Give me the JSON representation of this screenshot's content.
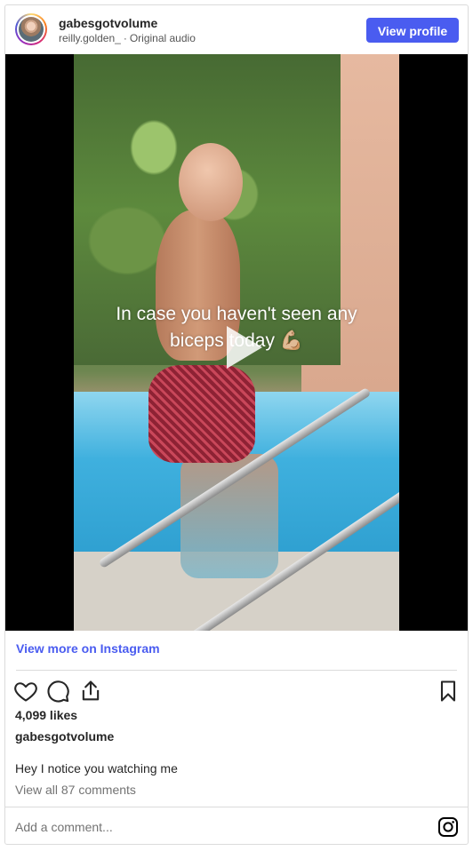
{
  "header": {
    "username": "gabesgotvolume",
    "audio_owner": "reilly.golden_",
    "separator": "·",
    "audio_label": "Original audio",
    "view_profile_label": "View profile"
  },
  "video": {
    "overlay_line1": "In case you haven't seen any",
    "overlay_line2": "biceps today 💪🏼"
  },
  "links": {
    "view_more": "View more on Instagram",
    "view_comments": "View all 87 comments"
  },
  "post": {
    "likes": "4,099 likes",
    "poster": "gabesgotvolume",
    "caption": "Hey I notice you watching me"
  },
  "comment": {
    "placeholder": "Add a comment..."
  },
  "icons": {
    "like": "heart-icon",
    "comment": "comment-bubble-icon",
    "share": "share-icon",
    "save": "bookmark-icon",
    "play": "play-icon",
    "brand": "instagram-icon"
  },
  "colors": {
    "accent": "#4a5cf0",
    "text": "#262626",
    "muted": "#737373",
    "border": "#dbdbdb"
  }
}
